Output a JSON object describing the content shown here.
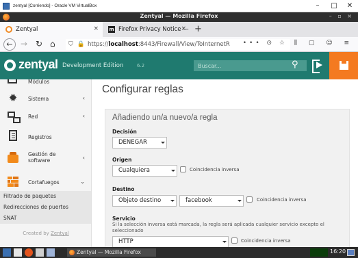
{
  "vbox": {
    "title": "zentyal [Corriendo] - Oracle VM VirtualBox",
    "minimize": "–",
    "maximize": "□",
    "close": "✕"
  },
  "firefox": {
    "window_title": "Zentyal — Mozilla Firefox",
    "window_controls": "– ▫ ×",
    "tabs": [
      {
        "label": "Zentyal",
        "close": "×"
      },
      {
        "label": "Firefox Privacy Notice —",
        "close": "×",
        "fav": "m"
      }
    ],
    "new_tab": "+",
    "url": {
      "prefix": "https://",
      "host": "localhost",
      "rest": ":8443/Firewall/View/ToInternetR"
    },
    "url_icons": "••• ⊙ ☆",
    "toolbar_icons": "⫼ ▢ ☺ ≡",
    "nav": {
      "back": "←",
      "forward": "→",
      "reload": "↻",
      "home": "⌂",
      "shield": "⛉",
      "lock": "🔒"
    }
  },
  "header": {
    "logo": "zentyal",
    "edition": "Development Edition",
    "version": "6.2",
    "search_placeholder": "Buscar...",
    "search_icon": "⚲"
  },
  "sidebar": {
    "items": [
      {
        "label": "Módulos",
        "icon": "modules-icon"
      },
      {
        "label": "Sistema",
        "icon": "gear-icon",
        "arrow": "‹"
      },
      {
        "label": "Red",
        "icon": "network-icon",
        "arrow": "‹"
      },
      {
        "label": "Registros",
        "icon": "document-icon"
      },
      {
        "label": "Gestión de",
        "label2": "software",
        "icon": "package-icon",
        "arrow": "‹"
      },
      {
        "label": "Cortafuegos",
        "icon": "firewall-icon",
        "arrow": "⌄"
      }
    ],
    "subitems": [
      "Filtrado de paquetes",
      "Redirecciones de puertos",
      "SNAT"
    ],
    "footer_prefix": "Created by ",
    "footer_link": "Zentyal"
  },
  "main": {
    "page_title": "Configurar reglas",
    "panel_title": "Añadiendo un/a nuevo/a regla",
    "decision": {
      "label": "Decisión",
      "value": "DENEGAR"
    },
    "origen": {
      "label": "Origen",
      "value": "Cualquiera",
      "inverse_label": "Coincidencia inversa"
    },
    "destino": {
      "label": "Destino",
      "value": "Objeto destino",
      "object": "facebook",
      "inverse_label": "Coincidencia inversa"
    },
    "servicio": {
      "label": "Servicio",
      "help": "Si la selección inversa está marcada, la regla será aplicada cualquier servicio excepto el seleccionado",
      "value": "HTTP",
      "inverse_label": "Coincidencia inversa"
    }
  },
  "taskbar": {
    "window_label": "Zentyal — Mozilla Firefox",
    "clock": "16:20"
  },
  "colors": {
    "header": "#1f7a6f",
    "accent": "#f47a20"
  }
}
